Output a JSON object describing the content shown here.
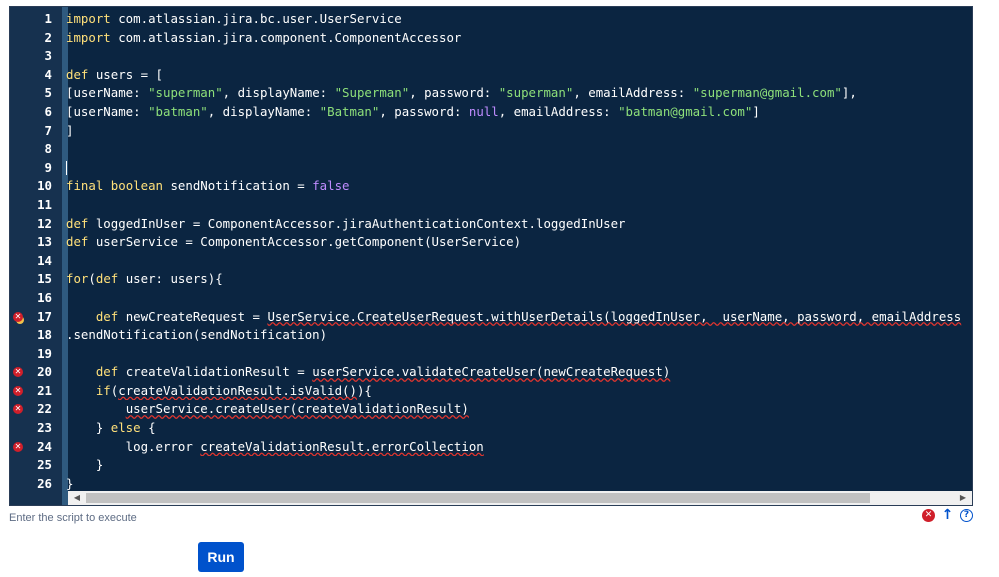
{
  "editor": {
    "lines": [
      {
        "n": "1",
        "tokens": [
          {
            "t": "import",
            "c": "kw"
          },
          {
            "t": " com.atlassian.jira.bc.user.UserService"
          }
        ]
      },
      {
        "n": "2",
        "tokens": [
          {
            "t": "import",
            "c": "kw"
          },
          {
            "t": " com.atlassian.jira.component.ComponentAccessor"
          }
        ]
      },
      {
        "n": "3",
        "tokens": []
      },
      {
        "n": "4",
        "tokens": [
          {
            "t": "def",
            "c": "kw"
          },
          {
            "t": " users = ["
          }
        ]
      },
      {
        "n": "5",
        "tokens": [
          {
            "t": "[userName: "
          },
          {
            "t": "\"superman\"",
            "c": "str"
          },
          {
            "t": ", displayName: "
          },
          {
            "t": "\"Superman\"",
            "c": "str"
          },
          {
            "t": ", password: "
          },
          {
            "t": "\"superman\"",
            "c": "str"
          },
          {
            "t": ", emailAddress: "
          },
          {
            "t": "\"superman@gmail.com\"",
            "c": "str"
          },
          {
            "t": "],"
          }
        ]
      },
      {
        "n": "6",
        "tokens": [
          {
            "t": "[userName: "
          },
          {
            "t": "\"batman\"",
            "c": "str"
          },
          {
            "t": ", displayName: "
          },
          {
            "t": "\"Batman\"",
            "c": "str"
          },
          {
            "t": ", password: "
          },
          {
            "t": "null",
            "c": "lit"
          },
          {
            "t": ", emailAddress: "
          },
          {
            "t": "\"batman@gmail.com\"",
            "c": "str"
          },
          {
            "t": "]"
          }
        ]
      },
      {
        "n": "7",
        "tokens": [
          {
            "t": "]"
          }
        ]
      },
      {
        "n": "8",
        "tokens": []
      },
      {
        "n": "9",
        "tokens": [],
        "cursor": true
      },
      {
        "n": "10",
        "tokens": [
          {
            "t": "final",
            "c": "kw"
          },
          {
            "t": " "
          },
          {
            "t": "boolean",
            "c": "kw"
          },
          {
            "t": " sendNotification = "
          },
          {
            "t": "false",
            "c": "lit"
          }
        ]
      },
      {
        "n": "11",
        "tokens": []
      },
      {
        "n": "12",
        "tokens": [
          {
            "t": "def",
            "c": "kw"
          },
          {
            "t": " loggedInUser = ComponentAccessor.jiraAuthenticationContext.loggedInUser"
          }
        ]
      },
      {
        "n": "13",
        "tokens": [
          {
            "t": "def",
            "c": "kw"
          },
          {
            "t": " userService = ComponentAccessor.getComponent(UserService)"
          }
        ]
      },
      {
        "n": "14",
        "tokens": []
      },
      {
        "n": "15",
        "tokens": [
          {
            "t": "for",
            "c": "kw"
          },
          {
            "t": "("
          },
          {
            "t": "def",
            "c": "kw"
          },
          {
            "t": " user: users){"
          }
        ]
      },
      {
        "n": "16",
        "tokens": []
      },
      {
        "n": "17",
        "marker": "error-warning",
        "tokens": [
          {
            "t": "    "
          },
          {
            "t": "def",
            "c": "kw"
          },
          {
            "t": " newCreateRequest = "
          },
          {
            "t": "UserService.CreateUserRequest.withUserDetails(loggedInUser,  userName, password, emailAddress",
            "c": "u"
          }
        ]
      },
      {
        "n": "18",
        "tokens": [
          {
            "t": ".sendNotification(sendNotification)"
          }
        ]
      },
      {
        "n": "19",
        "tokens": []
      },
      {
        "n": "20",
        "marker": "error",
        "tokens": [
          {
            "t": "    "
          },
          {
            "t": "def",
            "c": "kw"
          },
          {
            "t": " createValidationResult = "
          },
          {
            "t": "userService.validateCreateUser(newCreateRequest)",
            "c": "u"
          }
        ]
      },
      {
        "n": "21",
        "marker": "error",
        "tokens": [
          {
            "t": "    "
          },
          {
            "t": "if",
            "c": "kw"
          },
          {
            "t": "("
          },
          {
            "t": "createValidationResult.isValid()",
            "c": "u"
          },
          {
            "t": "){"
          }
        ]
      },
      {
        "n": "22",
        "marker": "error",
        "tokens": [
          {
            "t": "        "
          },
          {
            "t": "userService.createUser(createValidationResult)",
            "c": "u"
          }
        ]
      },
      {
        "n": "23",
        "tokens": [
          {
            "t": "    } "
          },
          {
            "t": "else",
            "c": "kw"
          },
          {
            "t": " {"
          }
        ]
      },
      {
        "n": "24",
        "marker": "error",
        "tokens": [
          {
            "t": "        log.error "
          },
          {
            "t": "createValidationResult.errorCollection",
            "c": "u"
          }
        ]
      },
      {
        "n": "25",
        "tokens": [
          {
            "t": "    }"
          }
        ]
      },
      {
        "n": "26",
        "tokens": [
          {
            "t": "}"
          }
        ]
      }
    ]
  },
  "hint": "Enter the script to execute",
  "run_label": "Run"
}
